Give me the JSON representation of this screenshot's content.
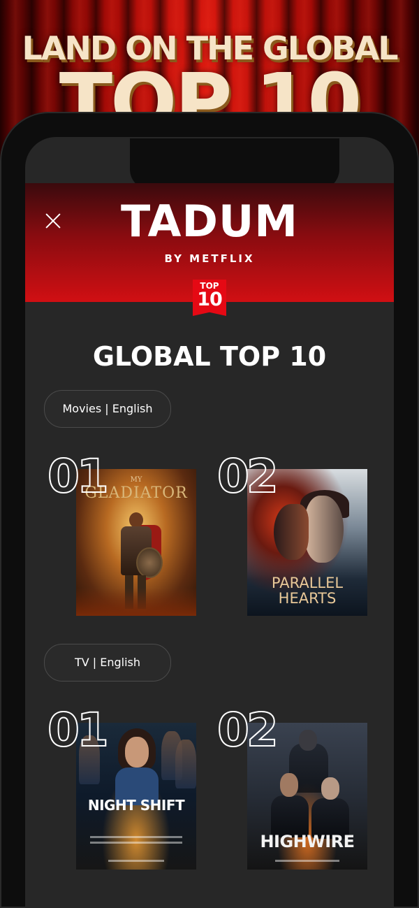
{
  "promo": {
    "headline_line1": "LAND ON THE GLOBAL",
    "headline_line2": "TOP 10"
  },
  "app": {
    "brand": "TADUM",
    "brand_sub": "BY METFLIX",
    "badge_top": "TOP",
    "badge_num": "10",
    "section_title": "GLOBAL TOP 10"
  },
  "categories": [
    {
      "label": "Movies | English",
      "items": [
        {
          "rank": "01",
          "pre": "MY",
          "title": "GLADIATOR"
        },
        {
          "rank": "02",
          "title_line1": "PARALLEL",
          "title_line2": "HEARTS"
        }
      ]
    },
    {
      "label": "TV | English",
      "items": [
        {
          "rank": "01",
          "title": "NIGHT SHIFT"
        },
        {
          "rank": "02",
          "title": "HIGHWIRE"
        }
      ]
    }
  ],
  "icons": {
    "close": "close-icon"
  },
  "colors": {
    "accent": "#e50914",
    "headline": "#f6e4c7",
    "screen_bg": "#272727"
  }
}
